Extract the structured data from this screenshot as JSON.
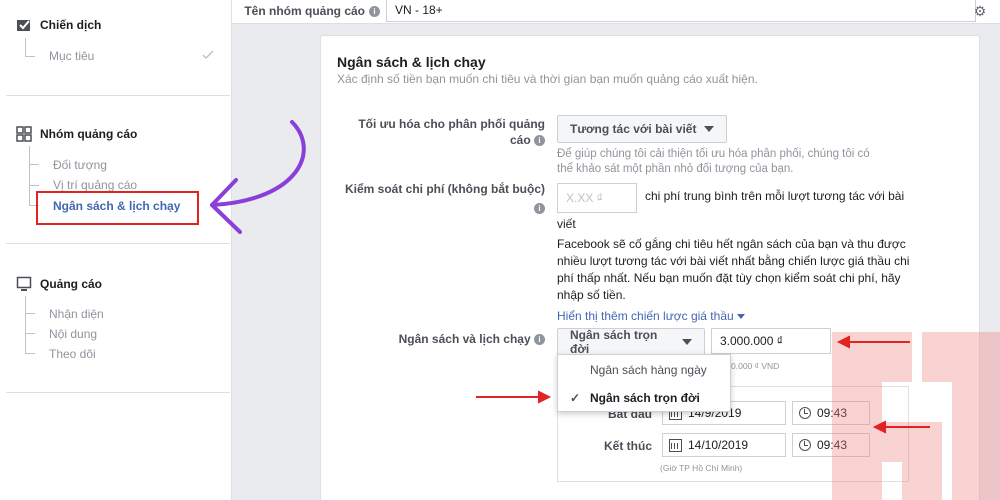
{
  "sidebar": {
    "campaign": {
      "title": "Chiến dịch",
      "items": [
        "Mục tiêu"
      ]
    },
    "adset": {
      "title": "Nhóm quảng cáo",
      "items": [
        "Đối tượng",
        "Vị trí quảng cáo",
        "Ngân sách & lịch chạy"
      ]
    },
    "ad": {
      "title": "Quảng cáo",
      "items": [
        "Nhận diện",
        "Nội dung",
        "Theo dõi"
      ]
    }
  },
  "adset_name": {
    "label": "Tên nhóm quảng cáo",
    "value": "VN - 18+"
  },
  "panel": {
    "title": "Ngân sách & lịch chạy",
    "subtitle": "Xác định số tiền bạn muốn chi tiêu và thời gian bạn muốn quảng cáo xuất hiện.",
    "optimization": {
      "label_line1": "Tối ưu hóa cho phân phối quảng",
      "label_line2": "cáo",
      "value": "Tương tác với bài viết",
      "hint_line1": "Để giúp chúng tôi cải thiện tối ưu hóa phân phối, chúng tôi có",
      "hint_line2": "thể khảo sát một phần nhỏ đối tượng của bạn."
    },
    "cost_control": {
      "label": "Kiểm soát chi phí (không bắt buộc)",
      "placeholder": "X.XX ₫",
      "desc_line1": "chi phí trung bình trên mỗi lượt tương tác với bài",
      "desc_line2": "viết",
      "para_line1": "Facebook sẽ cố gắng chi tiêu hết ngân sách của bạn và thu được",
      "para_line2": "nhiều lượt tương tác với bài viết nhất bằng chiến lược giá thầu chi",
      "para_line3": "phí thấp nhất. Nếu bạn muốn đặt tùy chọn kiểm soát chi phí, hãy",
      "para_line4": "nhập số tiền.",
      "link": "Hiển thị thêm chiến lược giá thầu"
    },
    "budget": {
      "label": "Ngân sách và lịch chạy",
      "type_value": "Ngân sách trọn đời",
      "amount": "3.000.000 ₫",
      "amount_hint": "0.000 ₫ VND",
      "options": [
        "Ngân sách hàng ngày",
        "Ngân sách trọn đời"
      ],
      "start_label": "Bắt đầu",
      "start_date": "14/9/2019",
      "start_time": "09:43",
      "end_label": "Kết thúc",
      "end_date": "14/10/2019",
      "end_time": "09:43",
      "timezone": "(Giờ TP Hồ Chí Minh)"
    }
  },
  "colors": {
    "accent": "#4267b2",
    "annotation_red": "#e02424",
    "annotation_purple": "#8b3fd9",
    "watermark": "#f08080"
  }
}
